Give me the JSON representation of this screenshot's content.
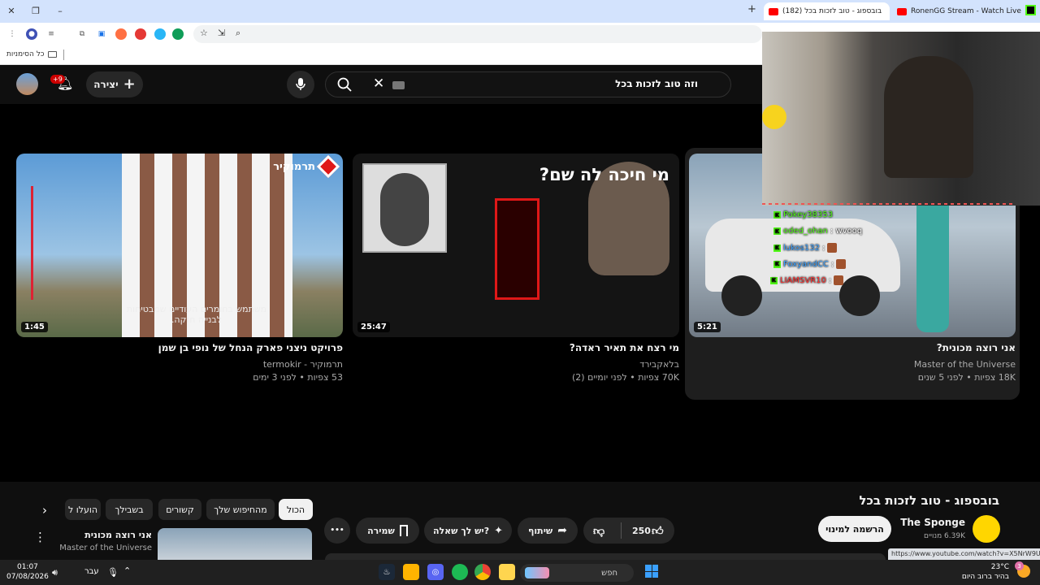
{
  "browser": {
    "tabs": [
      {
        "title": "RonenGG Stream - Watch Live o",
        "favicon": "#ff0000"
      },
      {
        "title": "(182) בובספוג - טוב לזכות בכל",
        "favicon": "#ff0000"
      }
    ],
    "new_tab": "+",
    "bookmarks_all": "כל הסימניות"
  },
  "youtube": {
    "search_query": "וזה טוב לזכות בכל",
    "create_label": "יצירה",
    "notif_count": "+9",
    "videos": [
      {
        "title": "אני רוצה מכונית?",
        "channel": "Master of the Universe",
        "meta": "18K צפיות • לפני 5 שנים",
        "duration": "5:21"
      },
      {
        "title": "מי רצח את תאיר ראדה?",
        "channel": "בלאקבירד",
        "meta": "70K צפיות • לפני יומיים (2)",
        "duration": "25:47",
        "thumb_text": "מי חיכה לה שם?"
      },
      {
        "title": "פרויקט ניצני פארק הנחל של נופי בן שמן",
        "channel": "תרמוקיר - termokir",
        "meta": "53 צפיות • לפני 3 ימים",
        "duration": "1:45",
        "thumb_logo": "תרמוקיר",
        "thumb_caption": "משתמש בחומרים העודיים שמבטיחות לבנייה חזקה."
      }
    ],
    "watch": {
      "title": "בובספוג - טוב לזכות בכל",
      "channel": "The Sponge",
      "subs": "6.39K מנויים",
      "subscribe": "הרשמה למינוי",
      "likes": "250",
      "share": "שיתוף",
      "ask": "יש לך שאלה?",
      "save": "שמירה",
      "more": "•••"
    },
    "chips": [
      "הכול",
      "מהחיפוש שלך",
      "קשורים",
      "בשבילך",
      "הועלו ל"
    ],
    "rec": {
      "title": "אני רוצה מכונית",
      "channel": "Master of the Universe"
    },
    "status_url": "https://www.youtube.com/watch?v=X5NrW9UE0L0"
  },
  "stream_chat": [
    {
      "user": "Pokey38353",
      "msg": "",
      "color": "#53fc18"
    },
    {
      "user": "oded_ohan",
      "msg": ": wvooq",
      "color": "#53fc18"
    },
    {
      "user": "lukos132",
      "msg": ":",
      "color": "#3aa0ff"
    },
    {
      "user": "FoxyandCC",
      "msg": ":",
      "color": "#3aa0ff"
    },
    {
      "user": "LIAMSVR10",
      "msg": ":",
      "color": "#ff3030"
    }
  ],
  "taskbar": {
    "search": "חפש",
    "time": "01:07",
    "date": "07/08/2026",
    "lang": "עבר",
    "weather_temp": "23°C",
    "weather_desc": "בהיר ברוב היום",
    "notif": "3"
  }
}
